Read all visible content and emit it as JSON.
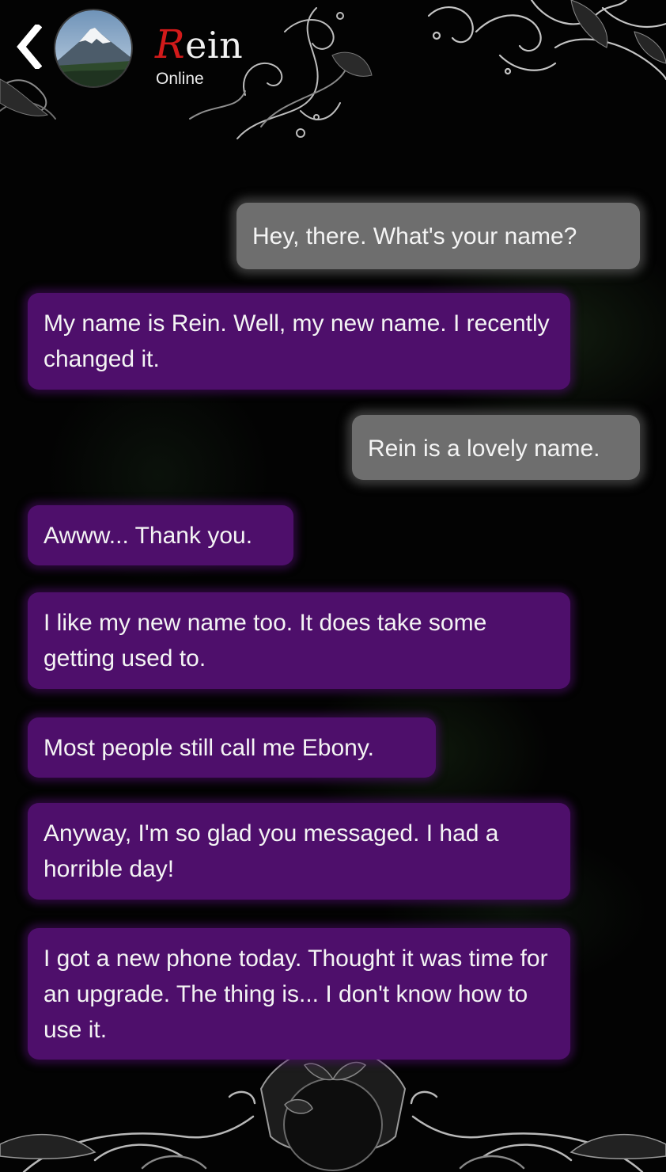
{
  "header": {
    "back_icon": "chevron-left-icon",
    "avatar_icon": "mountain-avatar",
    "name_first_letter": "R",
    "name_rest": "ein",
    "status": "Online"
  },
  "colors": {
    "incoming_bubble": "#4e0f6b",
    "outgoing_bubble": "#6e6e6e",
    "name_accent": "#d11a1a",
    "background": "#030303"
  },
  "messages": [
    {
      "from": "me",
      "text": "Hey, there. What's your name?"
    },
    {
      "from": "contact",
      "text": "My name is Rein. Well, my new name. I recently changed it."
    },
    {
      "from": "me",
      "text": "Rein is a lovely name."
    },
    {
      "from": "contact",
      "text": "Awww... Thank you."
    },
    {
      "from": "contact",
      "text": "I like my new name too. It does take some getting used to."
    },
    {
      "from": "contact",
      "text": "Most people still call me Ebony."
    },
    {
      "from": "contact",
      "text": "Anyway, I'm so glad you messaged. I had a horrible day!"
    },
    {
      "from": "contact",
      "text": "I got a new phone today. Thought it was time for an upgrade. The thing is... I don't know how to use it."
    }
  ]
}
